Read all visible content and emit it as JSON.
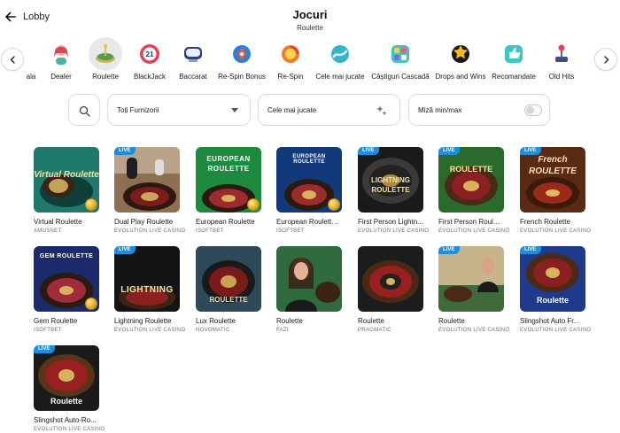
{
  "header": {
    "back_label": "Lobby",
    "title": "Jocuri",
    "subtitle": "Roulette"
  },
  "categories": [
    {
      "label": "ala",
      "icon": "partial-category-icon"
    },
    {
      "label": "Dealer",
      "icon": "dealer-icon"
    },
    {
      "label": "Roulette",
      "icon": "roulette-icon",
      "active": true
    },
    {
      "label": "BlackJack",
      "icon": "blackjack-icon"
    },
    {
      "label": "Baccarat",
      "icon": "baccarat-icon"
    },
    {
      "label": "Re-Spin Bonus",
      "icon": "respin-bonus-icon"
    },
    {
      "label": "Re-Spin",
      "icon": "respin-icon"
    },
    {
      "label": "Cele mai jucate",
      "icon": "most-played-icon"
    },
    {
      "label": "Câștiguri Cascadă",
      "icon": "cascade-wins-icon"
    },
    {
      "label": "Drops and Wins",
      "icon": "drops-and-wins-icon"
    },
    {
      "label": "Recomandate",
      "icon": "recommended-icon"
    },
    {
      "label": "Old Hits",
      "icon": "old-hits-icon"
    }
  ],
  "filters": {
    "provider": "Toți Furnizorii",
    "sort": "Cele mai jucate",
    "stake": "Miză min/max"
  },
  "games": [
    {
      "name": "Virtual Roulette",
      "provider": "AMUSNET",
      "live": false,
      "thumb_text": "Virtual Roulette"
    },
    {
      "name": "Dual Play Roulette",
      "provider": "EVOLUTION LIVE CASINO",
      "live": true,
      "thumb_text": ""
    },
    {
      "name": "European Roulette",
      "provider": "ISOFTBET",
      "live": false,
      "thumb_text": "EUROPEAN ROULETTE"
    },
    {
      "name": "European Roulette ...",
      "provider": "ISOFTBET",
      "live": false,
      "thumb_text": "EUROPEAN ROULETTE"
    },
    {
      "name": "First Person Lightn...",
      "provider": "EVOLUTION LIVE CASINO",
      "live": true,
      "thumb_text": "LIGHTNING ROULETTE"
    },
    {
      "name": "First Person Roulet...",
      "provider": "EVOLUTION LIVE CASINO",
      "live": true,
      "thumb_text": "ROULETTE"
    },
    {
      "name": "French Roulette",
      "provider": "EVOLUTION LIVE CASINO",
      "live": true,
      "thumb_text": "French ROULETTE"
    },
    {
      "name": "Gem Roulette",
      "provider": "ISOFTBET",
      "live": false,
      "thumb_text": "GEM ROULETTE"
    },
    {
      "name": "Lightning Roulette",
      "provider": "EVOLUTION LIVE CASINO",
      "live": true,
      "thumb_text": "LIGHTNING"
    },
    {
      "name": "Lux Roulette",
      "provider": "NOVOMATIC",
      "live": false,
      "thumb_text": "ROULETTE"
    },
    {
      "name": "Roulette",
      "provider": "FAZI",
      "live": false,
      "thumb_text": ""
    },
    {
      "name": "Roulette",
      "provider": "PRAGMATIC",
      "live": false,
      "thumb_text": ""
    },
    {
      "name": "Roulette",
      "provider": "EVOLUTION LIVE CASINO",
      "live": true,
      "thumb_text": ""
    },
    {
      "name": "Slingshot Auto Fr...",
      "provider": "EVOLUTION LIVE CASINO",
      "live": true,
      "thumb_text": "Roulette"
    },
    {
      "name": "Slingshot Auto-Ro...",
      "provider": "EVOLUTION LIVE CASINO",
      "live": true,
      "thumb_text": "Roulette"
    }
  ],
  "live_badge": "LIVE"
}
